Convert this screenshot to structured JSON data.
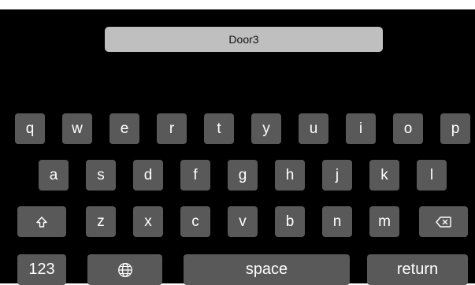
{
  "text_field": {
    "value": "Door3"
  },
  "keyboard": {
    "row1": [
      "q",
      "w",
      "e",
      "r",
      "t",
      "y",
      "u",
      "i",
      "o",
      "p"
    ],
    "row2": [
      "a",
      "s",
      "d",
      "f",
      "g",
      "h",
      "j",
      "k",
      "l"
    ],
    "row3": [
      "z",
      "x",
      "c",
      "v",
      "b",
      "n",
      "m"
    ],
    "shift_icon": "shift-icon",
    "backspace_icon": "backspace-icon",
    "numbers_label": "123",
    "globe_icon": "globe-icon",
    "space_label": "space",
    "return_label": "return"
  },
  "colors": {
    "background": "#000000",
    "key": "#595959",
    "key_text": "#ffffff",
    "field": "#bfbfbf"
  }
}
